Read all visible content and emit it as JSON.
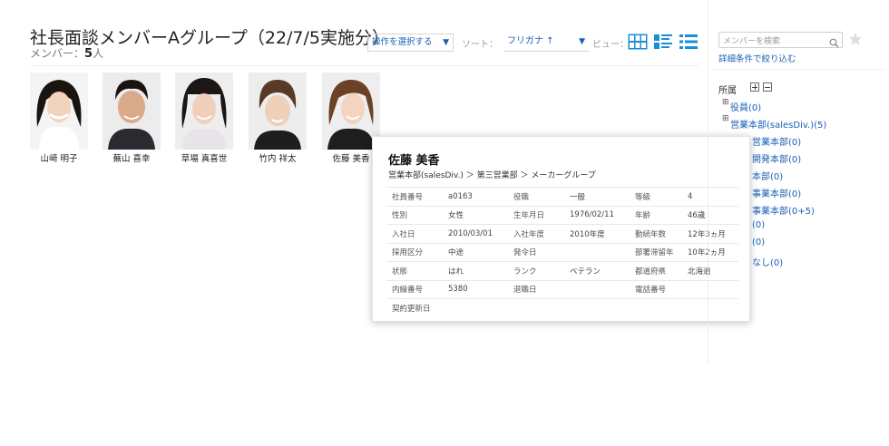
{
  "header": {
    "title": "社長面談メンバーAグループ（22/7/5実施分）",
    "member_label": "メンバー：",
    "member_count": "5",
    "member_unit": "人"
  },
  "toolbar": {
    "action_select": "操作を選択する",
    "sort_label": "ソート：",
    "sort_value": "フリガナ ↑",
    "view_label": "ビュー："
  },
  "members": [
    {
      "name": "山﨑 明子"
    },
    {
      "name": "蕪山 喜幸"
    },
    {
      "name": "草場 真喜世"
    },
    {
      "name": "竹内 祥太"
    },
    {
      "name": "佐藤 美香"
    }
  ],
  "popup": {
    "name": "佐藤 美香",
    "path": "営業本部(salesDiv.) ＞ 第三営業部 ＞ メーカーグループ",
    "rows": [
      [
        "社員番号",
        "a0163",
        "役職",
        "一般",
        "等級",
        "4"
      ],
      [
        "性別",
        "女性",
        "生年月日",
        "1976/02/11",
        "年齢",
        "46歳"
      ],
      [
        "入社日",
        "2010/03/01",
        "入社年度",
        "2010年度",
        "勤続年数",
        "12年3ヵ月"
      ],
      [
        "採用区分",
        "中途",
        "発令日",
        "",
        "部署滞留年",
        "10年2ヵ月"
      ],
      [
        "状態",
        "はれ",
        "ランク",
        "ベテラン",
        "都道府県",
        "北海道"
      ],
      [
        "内線番号",
        "5380",
        "退職日",
        "",
        "電話番号",
        ""
      ],
      [
        "契約更新日",
        "",
        "",
        "",
        "",
        ""
      ]
    ]
  },
  "sidebar": {
    "search_placeholder": "メンバーを検索",
    "advanced_link": "詳細条件で絞り込む",
    "belong_label": "所属",
    "tree": [
      "役員(0)",
      "営業本部(salesDiv.)(5)",
      "営業本部(0)",
      "開発本部(0)",
      "本部(0)",
      "事業本部(0)",
      "事業本部(0+5)",
      "(0)",
      "(0)",
      "なし(0)"
    ]
  },
  "colors": {
    "link": "#1a5fb4",
    "view_icon_active": "#1a8fd6"
  }
}
